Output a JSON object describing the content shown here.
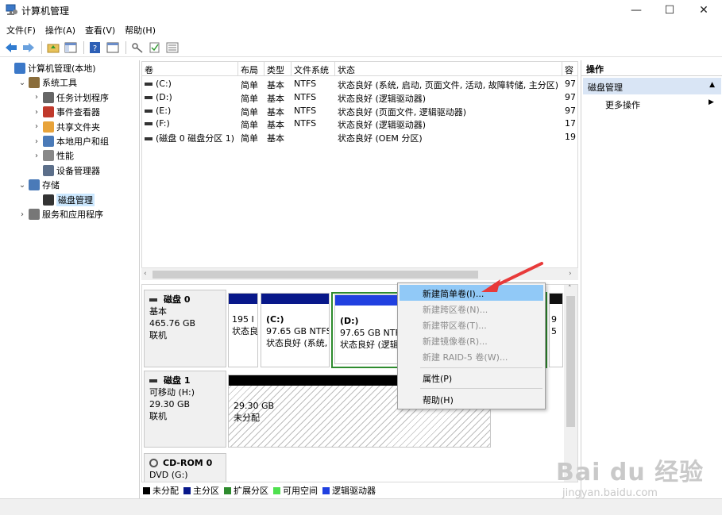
{
  "window": {
    "title": "计算机管理"
  },
  "menubar": {
    "items": [
      "文件(F)",
      "操作(A)",
      "查看(V)",
      "帮助(H)"
    ]
  },
  "tree": {
    "items": [
      {
        "label": "计算机管理(本地)",
        "level": 0,
        "expander": "",
        "icon": "computer-mgmt-icon"
      },
      {
        "label": "系统工具",
        "level": 1,
        "expander": "⌄",
        "icon": "tools-icon"
      },
      {
        "label": "任务计划程序",
        "level": 2,
        "expander": "›",
        "icon": "clock-icon"
      },
      {
        "label": "事件查看器",
        "level": 2,
        "expander": "›",
        "icon": "event-viewer-icon"
      },
      {
        "label": "共享文件夹",
        "level": 2,
        "expander": "›",
        "icon": "shared-folder-icon"
      },
      {
        "label": "本地用户和组",
        "level": 2,
        "expander": "›",
        "icon": "users-icon"
      },
      {
        "label": "性能",
        "level": 2,
        "expander": "›",
        "icon": "performance-icon"
      },
      {
        "label": "设备管理器",
        "level": 2,
        "expander": "",
        "icon": "device-manager-icon"
      },
      {
        "label": "存储",
        "level": 1,
        "expander": "⌄",
        "icon": "storage-icon"
      },
      {
        "label": "磁盘管理",
        "level": 2,
        "expander": "",
        "icon": "disk-management-icon",
        "selected": true
      },
      {
        "label": "服务和应用程序",
        "level": 1,
        "expander": "›",
        "icon": "services-icon"
      }
    ]
  },
  "volumes": {
    "columns": [
      "卷",
      "布局",
      "类型",
      "文件系统",
      "状态",
      "容"
    ],
    "rows": [
      {
        "vol": "(C:)",
        "layout": "简单",
        "type": "基本",
        "fs": "NTFS",
        "status": "状态良好 (系统, 启动, 页面文件, 活动, 故障转储, 主分区)",
        "cap": "97"
      },
      {
        "vol": "(D:)",
        "layout": "简单",
        "type": "基本",
        "fs": "NTFS",
        "status": "状态良好 (逻辑驱动器)",
        "cap": "97"
      },
      {
        "vol": "(E:)",
        "layout": "简单",
        "type": "基本",
        "fs": "NTFS",
        "status": "状态良好 (页面文件, 逻辑驱动器)",
        "cap": "97"
      },
      {
        "vol": "(F:)",
        "layout": "简单",
        "type": "基本",
        "fs": "NTFS",
        "status": "状态良好 (逻辑驱动器)",
        "cap": "17"
      },
      {
        "vol": "(磁盘 0 磁盘分区 1)",
        "layout": "简单",
        "type": "基本",
        "fs": "",
        "status": "状态良好 (OEM 分区)",
        "cap": "19"
      }
    ]
  },
  "disks": {
    "disk0": {
      "title": "磁盘 0",
      "type": "基本",
      "size": "465.76 GB",
      "state": "联机",
      "p1": {
        "line1": "195 I",
        "line2": "状态良"
      },
      "p2": {
        "name": "(C:)",
        "size": "97.65 GB NTFS",
        "status": "状态良好 (系统,"
      },
      "p3": {
        "name": "(D:)",
        "size": "97.65 GB NTFS",
        "status": "状态良好 (逻辑"
      },
      "p4": {
        "line1": "9",
        "line2": "5"
      }
    },
    "disk1": {
      "title": "磁盘 1",
      "type": "可移动 (H:)",
      "size": "29.30 GB",
      "state": "联机",
      "p1": {
        "size": "29.30 GB",
        "status": "未分配"
      }
    },
    "cdrom": {
      "title": "CD-ROM 0",
      "type": "DVD (G:)"
    }
  },
  "legend": [
    {
      "label": "未分配",
      "color": "#000000"
    },
    {
      "label": "主分区",
      "color": "#08188a"
    },
    {
      "label": "扩展分区",
      "color": "#2e8b2e"
    },
    {
      "label": "可用空间",
      "color": "#4fe04f"
    },
    {
      "label": "逻辑驱动器",
      "color": "#2040e0"
    }
  ],
  "actions": {
    "title": "操作",
    "section": "磁盘管理",
    "more": "更多操作"
  },
  "context_menu": {
    "items": [
      {
        "label": "新建简单卷(I)...",
        "state": "highlighted"
      },
      {
        "label": "新建跨区卷(N)...",
        "state": "disabled"
      },
      {
        "label": "新建带区卷(T)...",
        "state": "disabled"
      },
      {
        "label": "新建镜像卷(R)...",
        "state": "disabled"
      },
      {
        "label": "新建 RAID-5 卷(W)...",
        "state": "disabled"
      },
      {
        "label": "属性(P)",
        "state": "enabled"
      },
      {
        "label": "帮助(H)",
        "state": "enabled"
      }
    ]
  },
  "watermark": {
    "text": "Bai du 经验",
    "sub": "jingyan.baidu.com"
  },
  "colors": {
    "primary": "#08188a",
    "logical": "#2040e0",
    "selection": "#91c9f7",
    "arrow": "#e83a3a"
  }
}
